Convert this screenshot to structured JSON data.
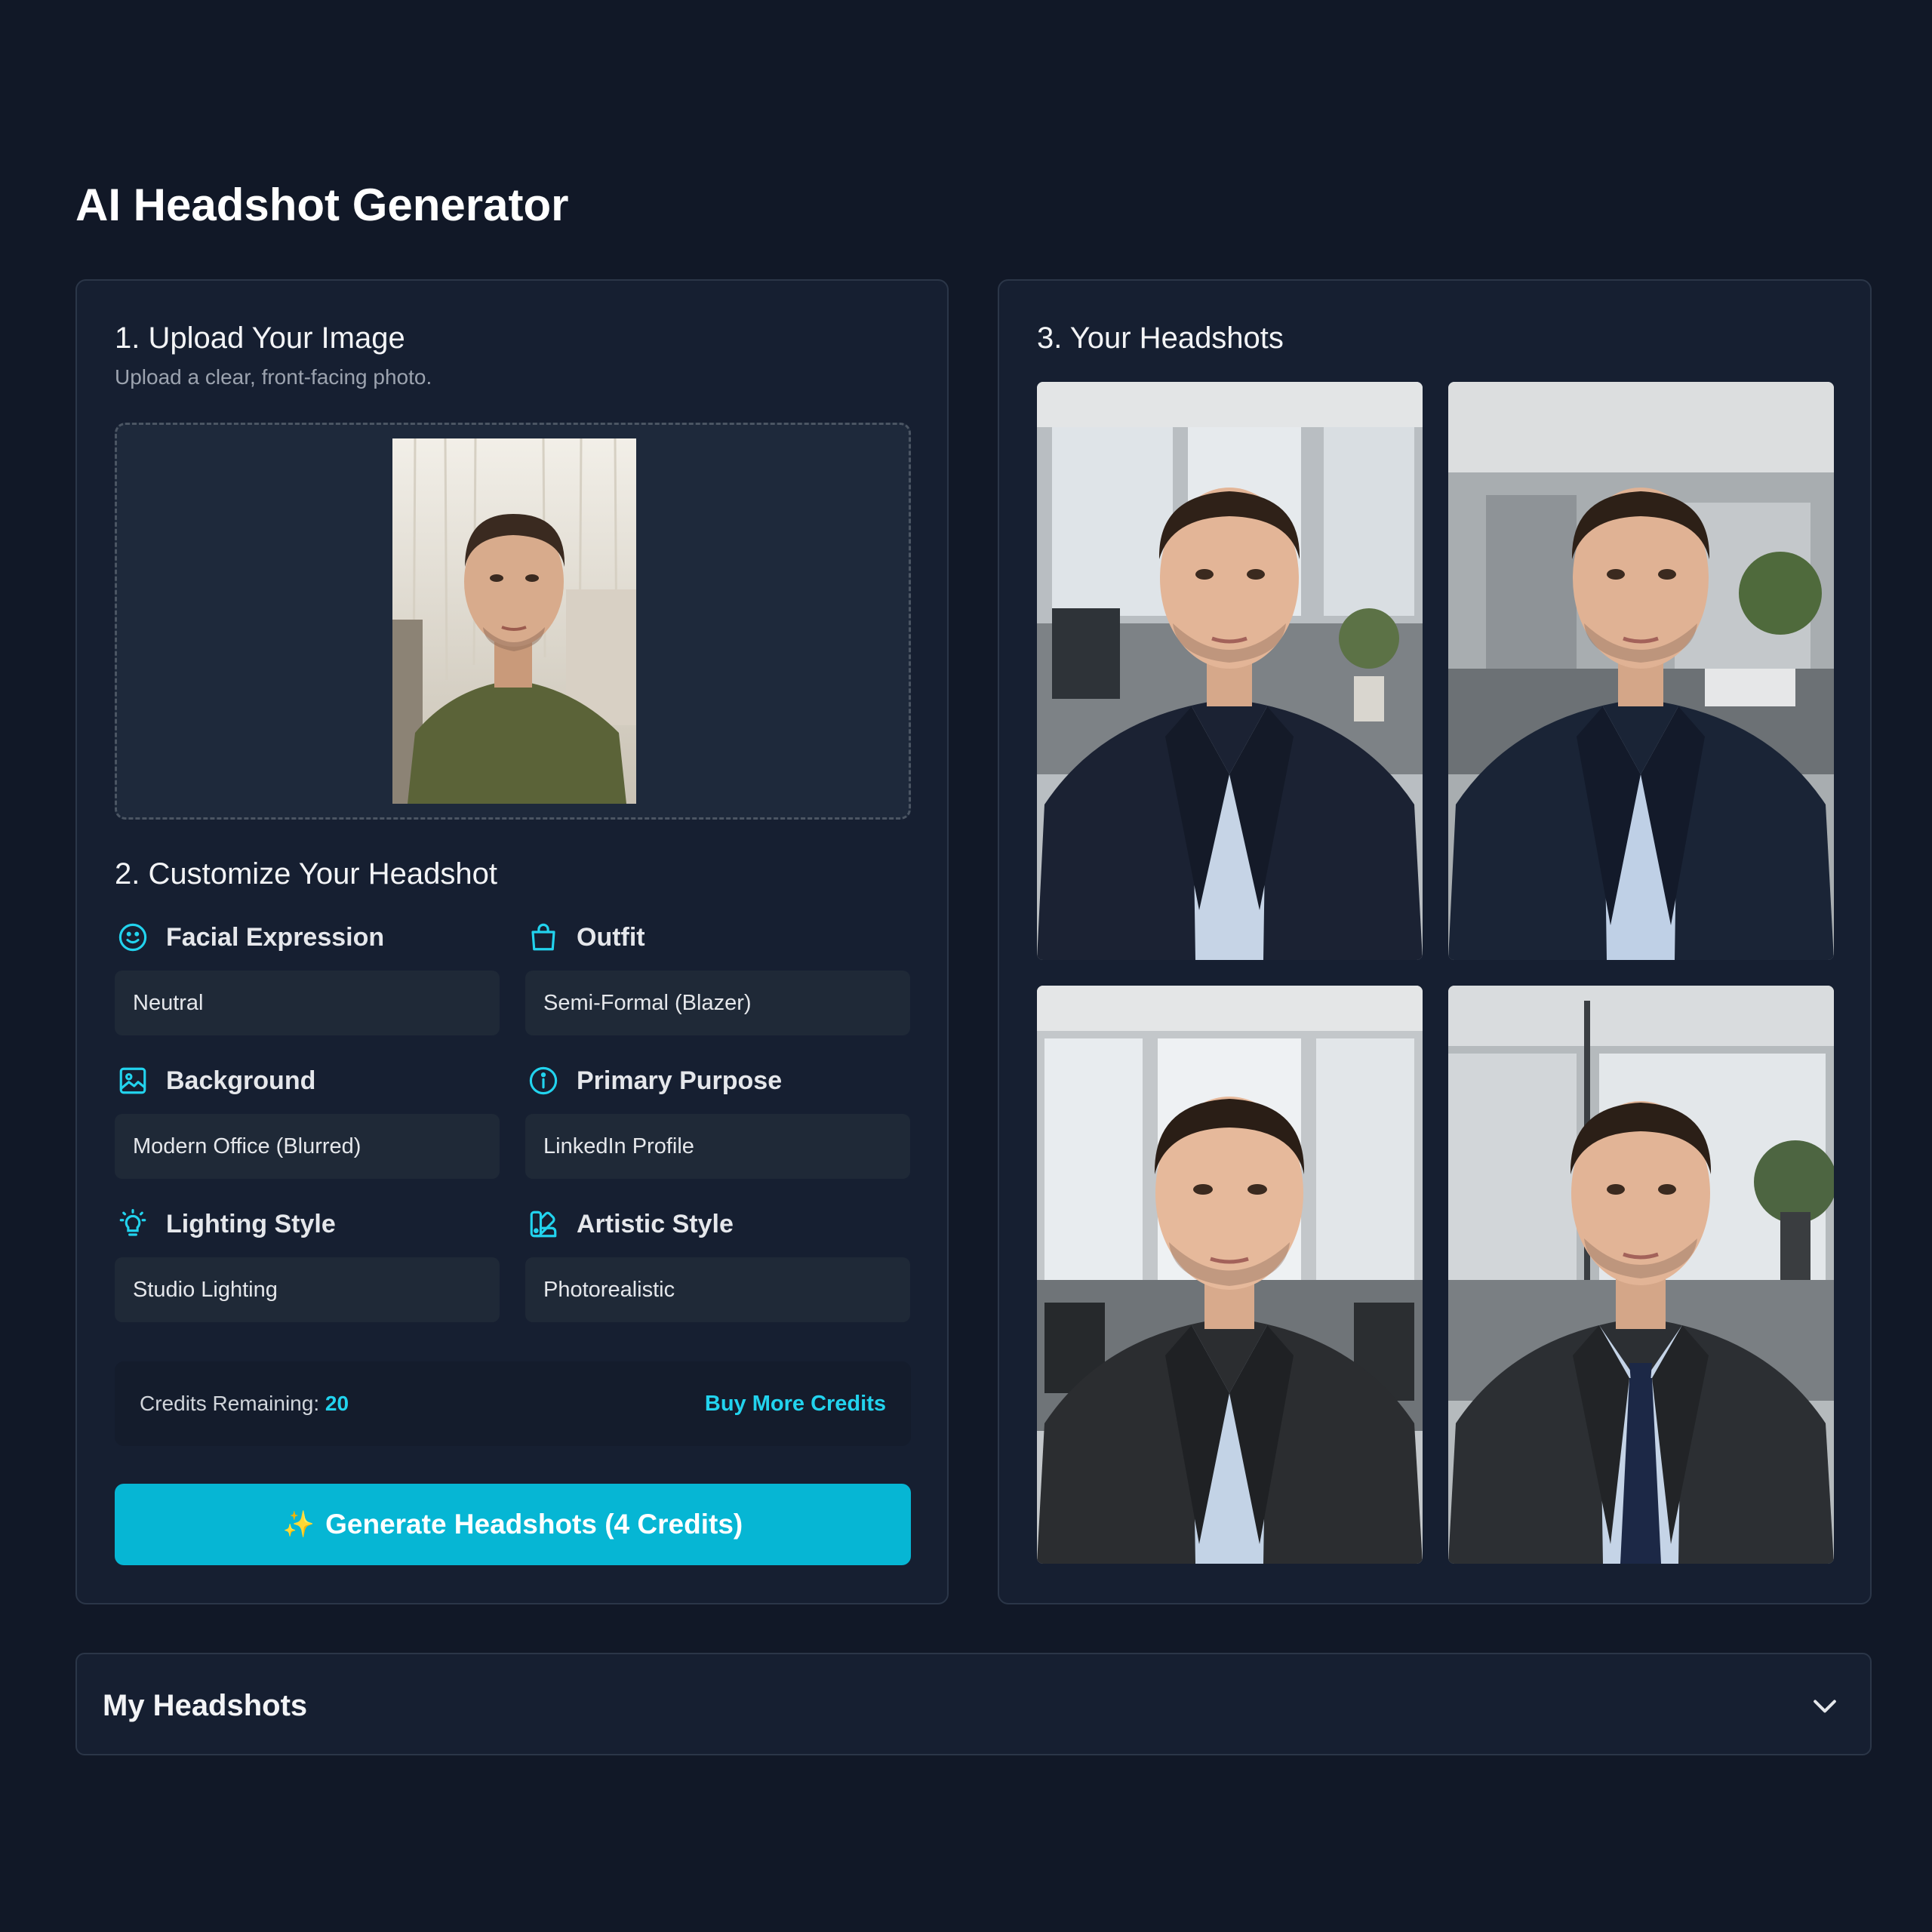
{
  "page": {
    "title": "AI Headshot Generator"
  },
  "upload": {
    "title": "1. Upload Your Image",
    "subtitle": "Upload a clear, front-facing photo."
  },
  "customize": {
    "title": "2. Customize Your Headshot",
    "fields": [
      {
        "label": "Facial Expression",
        "value": "Neutral",
        "icon": "smile-icon"
      },
      {
        "label": "Outfit",
        "value": "Semi-Formal (Blazer)",
        "icon": "shopping-bag-icon"
      },
      {
        "label": "Background",
        "value": "Modern Office (Blurred)",
        "icon": "image-icon"
      },
      {
        "label": "Primary Purpose",
        "value": "LinkedIn Profile",
        "icon": "info-icon"
      },
      {
        "label": "Lighting Style",
        "value": "Studio Lighting",
        "icon": "lightbulb-icon"
      },
      {
        "label": "Artistic Style",
        "value": "Photorealistic",
        "icon": "palette-icon"
      }
    ]
  },
  "credits": {
    "label": "Credits Remaining:",
    "count": "20",
    "buy_label": "Buy More Credits"
  },
  "generate": {
    "icon": "sparkles-icon",
    "label": "Generate Headshots (4 Credits)"
  },
  "results": {
    "title": "3. Your Headshots"
  },
  "history": {
    "title": "My Headshots",
    "icon": "chevron-down-icon"
  },
  "colors": {
    "accent": "#06b6d4",
    "accent_text": "#22d3ee",
    "background": "#111827",
    "panel": "#161f31"
  }
}
